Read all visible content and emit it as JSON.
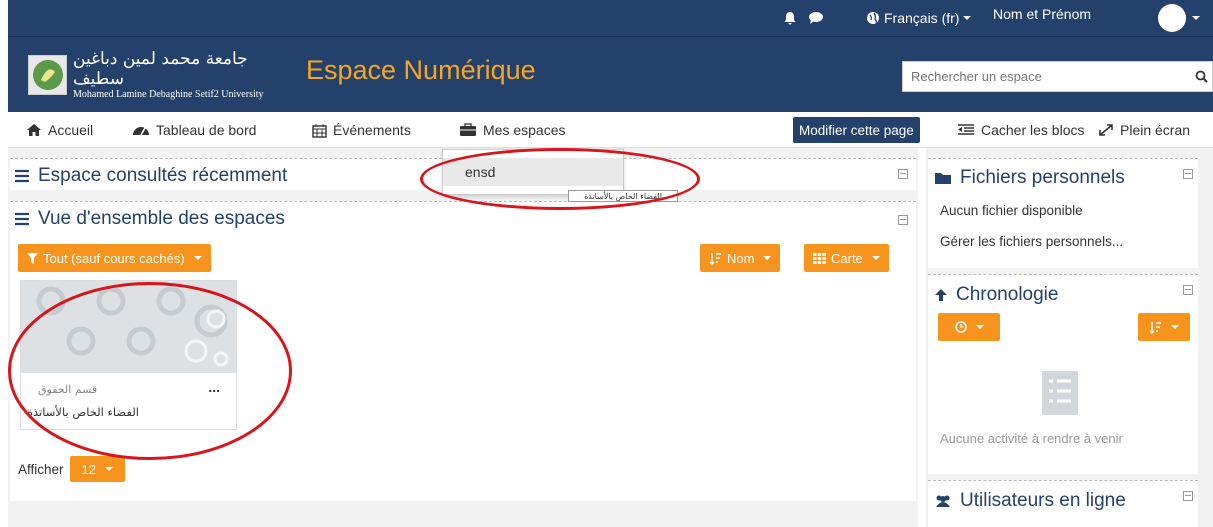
{
  "topbar": {
    "language": "Français (fr)",
    "user_name": "Nom et Prénom",
    "bell_icon": "bell-icon",
    "chat_icon": "chat-icon",
    "globe_icon": "globe-icon"
  },
  "header": {
    "logo_ar": "جامعة محمد لمين دباغين سطيف",
    "logo_en": "Mohamed Lamine Debaghine Setif2 University",
    "site_title": "Espace Numérique",
    "search_placeholder": "Rechercher un espace"
  },
  "nav": {
    "home": "Accueil",
    "dashboard": "Tableau de bord",
    "events": "Événements",
    "my_spaces": "Mes espaces",
    "edit_page": "Modifier cette page",
    "hide_blocks": "Cacher les blocs",
    "fullscreen": "Plein écran"
  },
  "dropdown": {
    "item": "ensd",
    "tooltip": "الفضاء الخاص بالأساتذة"
  },
  "main": {
    "recent_title": "Espace consultés récemment",
    "overview_title": "Vue d'ensemble des espaces",
    "filter_label": "Tout (sauf cours cachés)",
    "sort_label": "Nom",
    "view_label": "Carte",
    "card_category": "قسم الحقوق",
    "card_title": "الفضاء الخاص بالأساتذة",
    "card_menu": "...",
    "show_label": "Afficher",
    "show_count": "12"
  },
  "sidebar": {
    "files_title": "Fichiers personnels",
    "files_none": "Aucun fichier disponible",
    "files_manage": "Gérer les fichiers personnels...",
    "timeline_title": "Chronologie",
    "timeline_empty": "Aucune activité à rendre à venir",
    "online_title": "Utilisateurs en ligne"
  },
  "colors": {
    "brand": "#24416b",
    "accent": "#f7941d",
    "title_orange": "#f5a623",
    "annotation_red": "#d9141b"
  }
}
